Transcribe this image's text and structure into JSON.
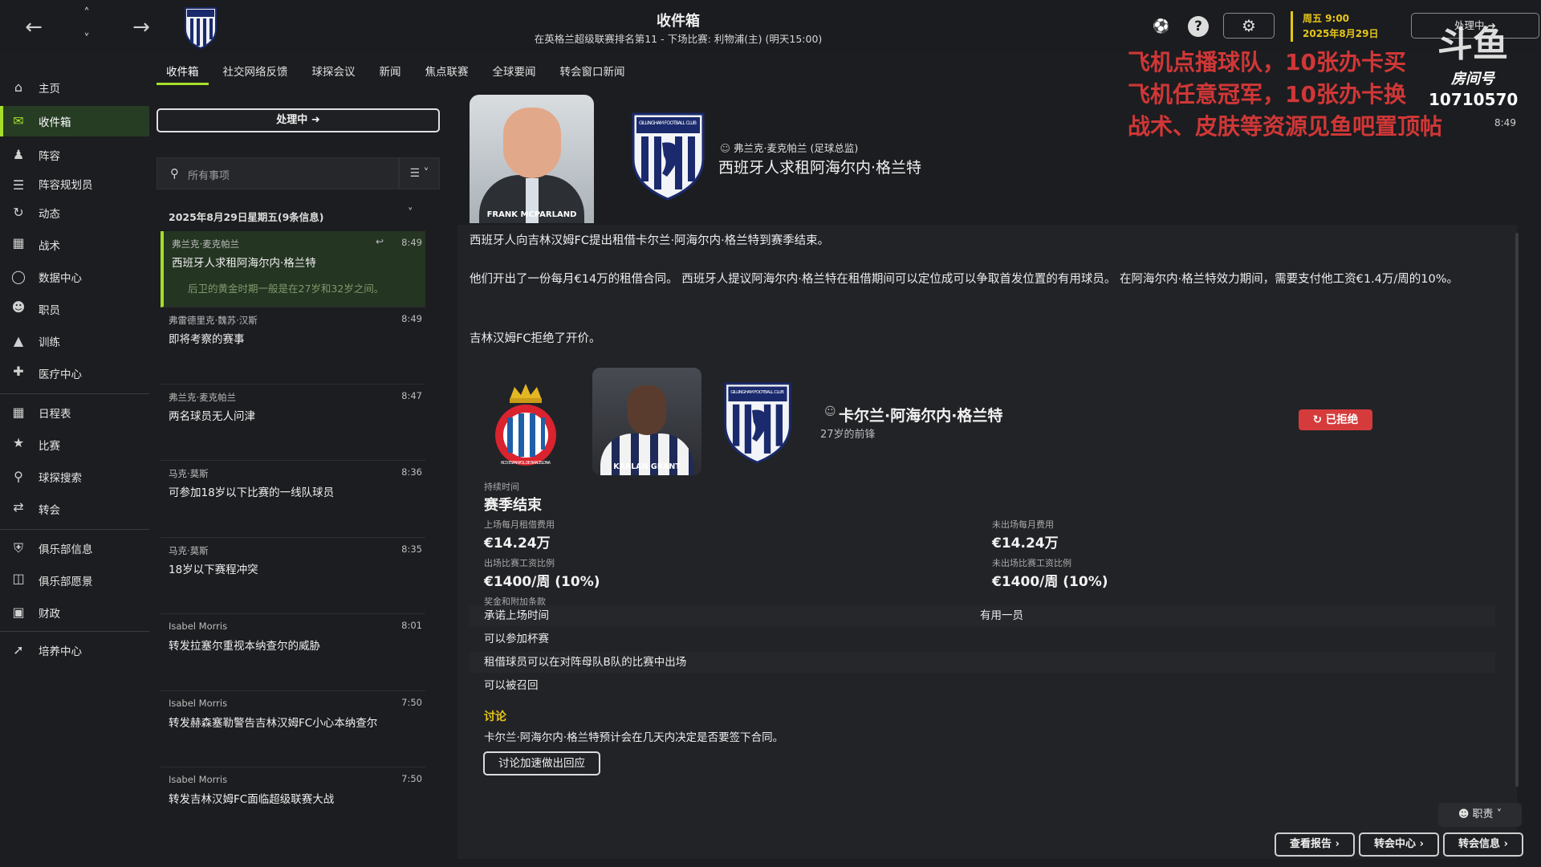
{
  "header": {
    "title": "收件箱",
    "subtitle": "在英格兰超级联赛排名第11 - 下场比赛: 利物浦(主) (明天15:00)",
    "date_line1": "周五 9:00",
    "date_line2": "2025年8月29日",
    "continue_label": "处理中",
    "back_icon": "arrow-left",
    "forward_icon": "arrow-right"
  },
  "overlay": {
    "lines": [
      "飞机点播球队，10张办卡买",
      "飞机任意冠军，10张办卡换",
      "战术、皮肤等资源见鱼吧置顶帖"
    ],
    "room_label": "房间号",
    "room_number": "10710570",
    "time": "8:49"
  },
  "sidebar": {
    "items": [
      {
        "label": "主页",
        "icon": "home-icon"
      },
      {
        "label": "收件箱",
        "icon": "inbox-icon",
        "active": true
      },
      {
        "label": "阵容",
        "icon": "squad-icon"
      },
      {
        "label": "阵容规划员",
        "icon": "planner-icon"
      },
      {
        "label": "动态",
        "icon": "dynamics-icon"
      },
      {
        "label": "战术",
        "icon": "tactics-icon"
      },
      {
        "label": "数据中心",
        "icon": "data-hub-icon"
      },
      {
        "label": "职员",
        "icon": "staff-icon"
      },
      {
        "label": "训练",
        "icon": "training-icon"
      },
      {
        "label": "医疗中心",
        "icon": "medical-icon"
      },
      {
        "label": "日程表",
        "icon": "schedule-icon"
      },
      {
        "label": "比赛",
        "icon": "trophy-icon"
      },
      {
        "label": "球探搜索",
        "icon": "scouting-icon"
      },
      {
        "label": "转会",
        "icon": "transfer-icon"
      },
      {
        "label": "俱乐部信息",
        "icon": "club-info-icon"
      },
      {
        "label": "俱乐部愿景",
        "icon": "club-vision-icon"
      },
      {
        "label": "财政",
        "icon": "finance-icon"
      },
      {
        "label": "培养中心",
        "icon": "development-icon"
      }
    ]
  },
  "tabs": [
    "收件箱",
    "社交网络反馈",
    "球探会议",
    "新闻",
    "焦点联赛",
    "全球要闻",
    "转会窗口新闻"
  ],
  "inbox": {
    "continue_label": "处理中",
    "search_placeholder": "所有事项",
    "group_header": "2025年8月29日星期五(9条信息)",
    "messages": [
      {
        "sender": "弗兰克·麦克帕兰",
        "time": "8:49",
        "subject": "西班牙人求租阿海尔内·格兰特",
        "preview": "后卫的黄金时期一般是在27岁和32岁之间。"
      },
      {
        "sender": "弗雷德里克·魏苏·汉斯",
        "time": "8:49",
        "subject": "即将考察的赛事"
      },
      {
        "sender": "弗兰克·麦克帕兰",
        "time": "8:47",
        "subject": "两名球员无人问津"
      },
      {
        "sender": "马克·莫斯",
        "time": "8:36",
        "subject": "可参加18岁以下比赛的一线队球员"
      },
      {
        "sender": "马克·莫斯",
        "time": "8:35",
        "subject": "18岁以下赛程冲突"
      },
      {
        "sender": "Isabel Morris",
        "time": "8:01",
        "subject": "转发拉塞尔重视本纳查尔的威胁"
      },
      {
        "sender": "Isabel Morris",
        "time": "7:50",
        "subject": "转发赫森塞勒警告吉林汉姆FC小心本纳查尔"
      },
      {
        "sender": "Isabel Morris",
        "time": "7:50",
        "subject": "转发吉林汉姆FC面临超级联赛大战"
      }
    ]
  },
  "detail": {
    "sender_role": "弗兰克·麦克帕兰 (足球总监)",
    "sender_photo_caption": "FRANK MCPARLAND",
    "title": "西班牙人求租阿海尔内·格兰特",
    "para1": "西班牙人向吉林汉姆FC提出租借卡尔兰·阿海尔内·格兰特到赛季结束。",
    "para2": "他们开出了一份每月€14万的租借合同。 西班牙人提议阿海尔内·格兰特在租借期间可以定位成可以争取首发位置的有用球员。 在阿海尔内·格兰特效力期间，需要支付他工资€1.4万/周的10%。",
    "para3": "吉林汉姆FC拒绝了开价。",
    "crest_text_1": "GILLINGHAM FOOTBALL CLUB",
    "esp_crest_text": "RCD ESPANYOL DE BARCELONA",
    "player_photo_caption": "KARLAN GRANT",
    "player_name": "卡尔兰·阿海尔内·格兰特",
    "player_desc": "27岁的前锋",
    "status": "已拒绝",
    "fields": {
      "duration_label": "持续时间",
      "duration_value": "赛季结束",
      "played_fee_label": "上场每月租借费用",
      "played_fee_value": "€14.24万",
      "unplayed_fee_label": "未出场每月费用",
      "unplayed_fee_value": "€14.24万",
      "played_wage_label": "出场比赛工资比例",
      "played_wage_value": "€1400/周 (10%)",
      "unplayed_wage_label": "未出场比赛工资比例",
      "unplayed_wage_value": "€1400/周 (10%)",
      "bonus_label": "奖金和附加条款"
    },
    "rows": [
      {
        "left": "承诺上场时间",
        "right": "有用一员"
      },
      {
        "left": "可以参加杯赛",
        "right": ""
      },
      {
        "left": "租借球员可以在对阵母队B队的比赛中出场",
        "right": ""
      },
      {
        "left": "可以被召回",
        "right": ""
      }
    ],
    "discussion_label": "讨论",
    "discussion_text": "卡尔兰·阿海尔内·格兰特预计会在几天内决定是否要签下合同。",
    "discussion_button": "讨论加速做出回应"
  },
  "footer": {
    "staff_label": "职责",
    "buttons": [
      "查看报告",
      "转会中心",
      "转会信息"
    ]
  },
  "colors": {
    "accent": "#a6df2a",
    "date": "#e6c619",
    "rejected": "#d63b3b",
    "overlay_text": "#f03c3c"
  }
}
